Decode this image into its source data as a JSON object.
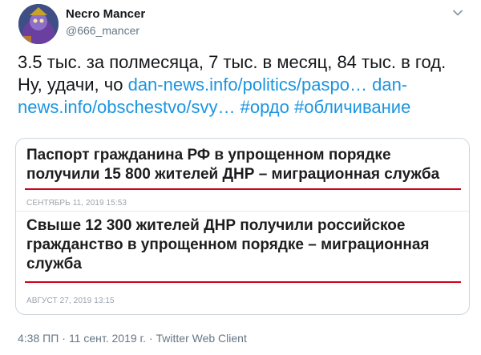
{
  "user": {
    "display_name": "Necro Mancer",
    "handle": "@666_mancer"
  },
  "tweet": {
    "text_line1": "3.5 тыс. за полмесяца, 7 тыс. в месяц, 84 тыс. в год.",
    "text_prefix": "Ну, удачи, чо",
    "link1": "dan-news.info/politics/paspo…",
    "link2": "dan-news.info/obschestvo/svy…",
    "hashtag1": "#ордо",
    "hashtag2": "#обличивание"
  },
  "cards": [
    {
      "title_line1": "Паспорт гражданина РФ в упрощенном порядке",
      "title_line2": "получили 15 800 жителей ДНР – миграционная служба",
      "date": "СЕНТЯБРЬ 11, 2019 15:53"
    },
    {
      "title_line1": "Свыше 12 300 жителей ДНР получили российское",
      "title_line2": "гражданство в упрощенном порядке – миграционная",
      "title_line3": "служба",
      "date": "АВГУСТ 27, 2019 13:15"
    }
  ],
  "meta": {
    "time": "4:38 ПП",
    "separator": "·",
    "date": "11 сент. 2019 г.",
    "client": "Twitter Web Client"
  },
  "colors": {
    "link": "#1b95e0",
    "accent_red": "#d0021b",
    "secondary_text": "#657786"
  },
  "icons": {
    "caret": "chevron-down-icon"
  }
}
